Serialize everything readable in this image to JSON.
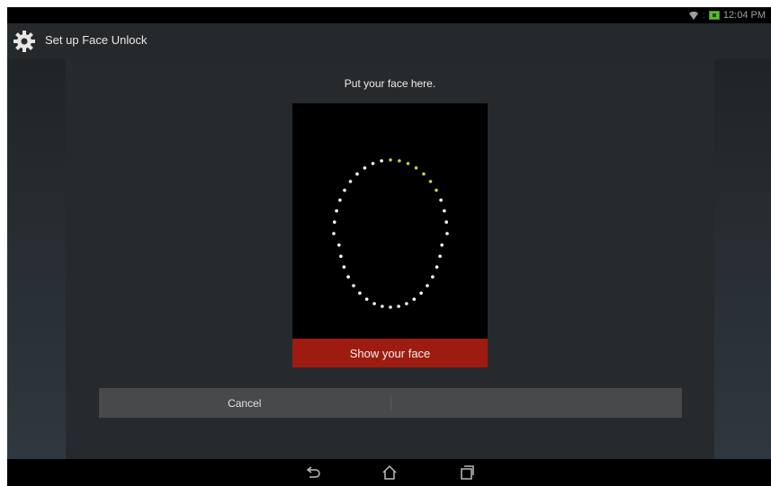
{
  "status_bar": {
    "time": "12:04 PM",
    "icons": [
      "wifi-icon",
      "battery-charging-icon"
    ]
  },
  "action_bar": {
    "title": "Set up Face Unlock",
    "icon": "gear-icon"
  },
  "main": {
    "instruction": "Put your face here.",
    "show_face_label": "Show your face"
  },
  "buttons": {
    "cancel": "Cancel",
    "continue": ""
  },
  "nav_bar": {
    "icons": [
      "back-icon",
      "home-icon",
      "recent-apps-icon"
    ]
  },
  "colors": {
    "accent_red": "#9e1b11",
    "progress_dot": "#c5d34a",
    "dot": "#ffffff",
    "battery": "#5fb82d"
  },
  "face_guide": {
    "total_dots": 40,
    "progress_dots": 7
  }
}
